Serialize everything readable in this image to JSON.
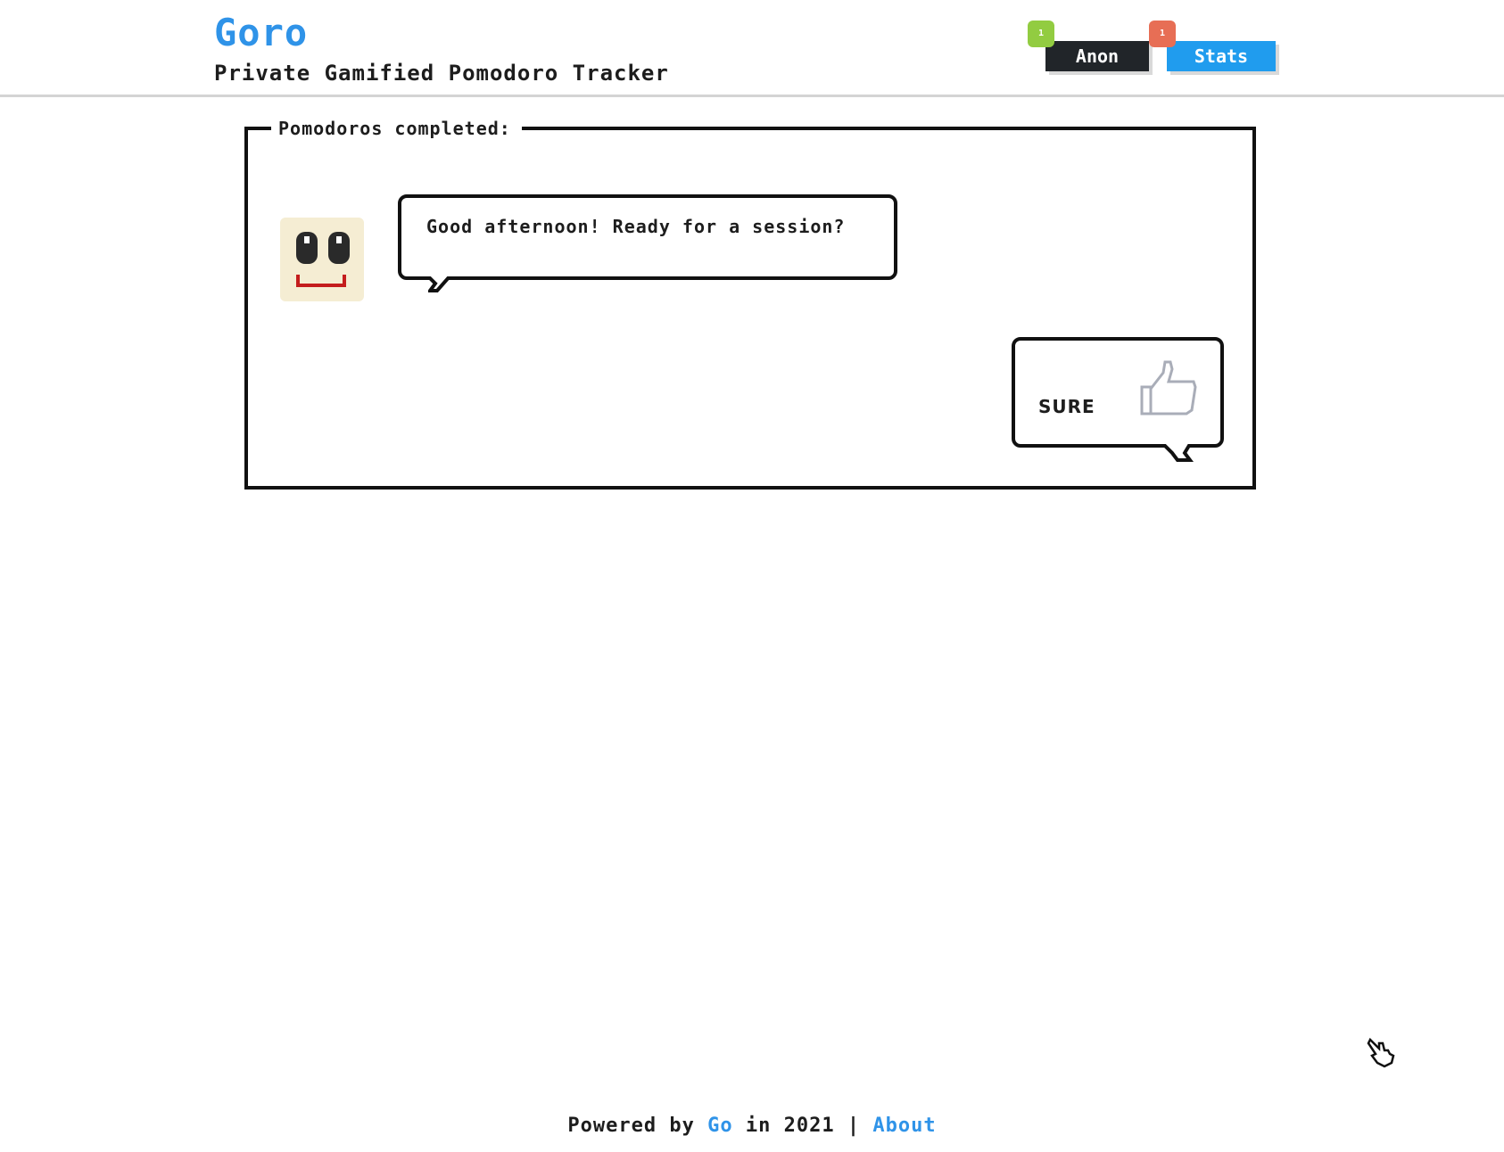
{
  "header": {
    "title": "Goro",
    "subtitle": "Private Gamified Pomodoro Tracker",
    "nav": {
      "anon_label": "Anon",
      "anon_badge": "1",
      "stats_label": "Stats",
      "stats_badge": "1"
    }
  },
  "main": {
    "section_title": "Pomodoros completed:",
    "greeting": "Good afternoon! Ready for a session?",
    "reply_label": "SURE",
    "reply_icon": "thumbs-up-icon",
    "avatar_icon": "smiley-face-icon"
  },
  "footer": {
    "prefix": "Powered by",
    "go_link": "Go",
    "middle": "in 2021",
    "separator": "|",
    "about_link": "About"
  },
  "colors": {
    "brand": "#2f93e8",
    "anon_button": "#212529",
    "stats_button": "#209cee",
    "badge_green": "#92cc41",
    "badge_red": "#e76e55",
    "mouth": "#c41d1d",
    "avatar_bg": "#f5edd3"
  }
}
